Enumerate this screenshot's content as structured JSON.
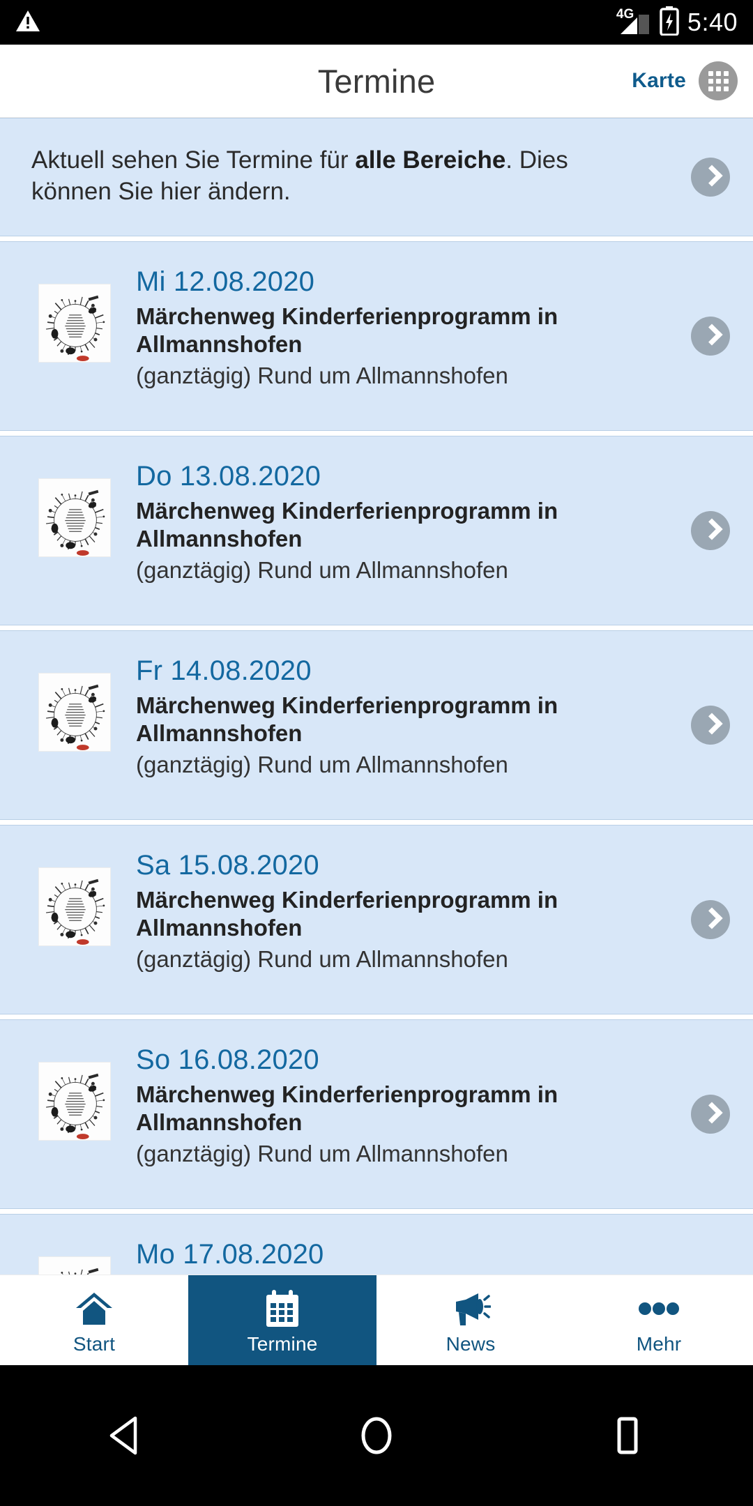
{
  "status_bar": {
    "warning_icon": "warning-triangle-icon",
    "network_label": "4G",
    "signal_icon": "signal-bars-icon",
    "battery_icon": "battery-charging-icon",
    "time": "5:40"
  },
  "header": {
    "title": "Termine",
    "map_label": "Karte",
    "grid_icon": "apps-grid-icon"
  },
  "banner": {
    "text_before": "Aktuell sehen Sie Termine für ",
    "text_bold": "alle Bereiche",
    "text_after": ". Dies können Sie hier ändern.",
    "chevron_icon": "chevron-right-icon"
  },
  "events": [
    {
      "date": "Mi 12.08.2020",
      "title": "Märchenweg Kinderferienprogramm in Allmannshofen",
      "subtitle": "(ganztägig) Rund um Allmannshofen",
      "thumb_icon": "event-flyer-thumbnail",
      "chevron_icon": "chevron-right-icon"
    },
    {
      "date": "Do 13.08.2020",
      "title": "Märchenweg Kinderferienprogramm in Allmannshofen",
      "subtitle": "(ganztägig) Rund um Allmannshofen",
      "thumb_icon": "event-flyer-thumbnail",
      "chevron_icon": "chevron-right-icon"
    },
    {
      "date": "Fr 14.08.2020",
      "title": "Märchenweg Kinderferienprogramm in Allmannshofen",
      "subtitle": "(ganztägig) Rund um Allmannshofen",
      "thumb_icon": "event-flyer-thumbnail",
      "chevron_icon": "chevron-right-icon"
    },
    {
      "date": "Sa 15.08.2020",
      "title": "Märchenweg Kinderferienprogramm in Allmannshofen",
      "subtitle": "(ganztägig) Rund um Allmannshofen",
      "thumb_icon": "event-flyer-thumbnail",
      "chevron_icon": "chevron-right-icon"
    },
    {
      "date": "So 16.08.2020",
      "title": "Märchenweg Kinderferienprogramm in Allmannshofen",
      "subtitle": "(ganztägig) Rund um Allmannshofen",
      "thumb_icon": "event-flyer-thumbnail",
      "chevron_icon": "chevron-right-icon"
    },
    {
      "date": "Mo 17.08.2020",
      "title": "",
      "subtitle": "",
      "thumb_icon": "event-flyer-thumbnail",
      "chevron_icon": "chevron-right-icon"
    }
  ],
  "tabs": [
    {
      "label": "Start",
      "icon": "home-icon",
      "active": false
    },
    {
      "label": "Termine",
      "icon": "calendar-icon",
      "active": true
    },
    {
      "label": "News",
      "icon": "megaphone-icon",
      "active": false
    },
    {
      "label": "Mehr",
      "icon": "more-dots-icon",
      "active": false
    }
  ],
  "nav_bar": {
    "back_icon": "back-triangle-icon",
    "home_icon": "home-circle-icon",
    "recents_icon": "recents-square-icon"
  },
  "colors": {
    "card_bg": "#d8e7f8",
    "card_border": "#b9cfe6",
    "accent": "#115580",
    "date_blue": "#1368a0",
    "chevron_bg": "#9aa7b3",
    "tab_active_bg": "#115580"
  }
}
